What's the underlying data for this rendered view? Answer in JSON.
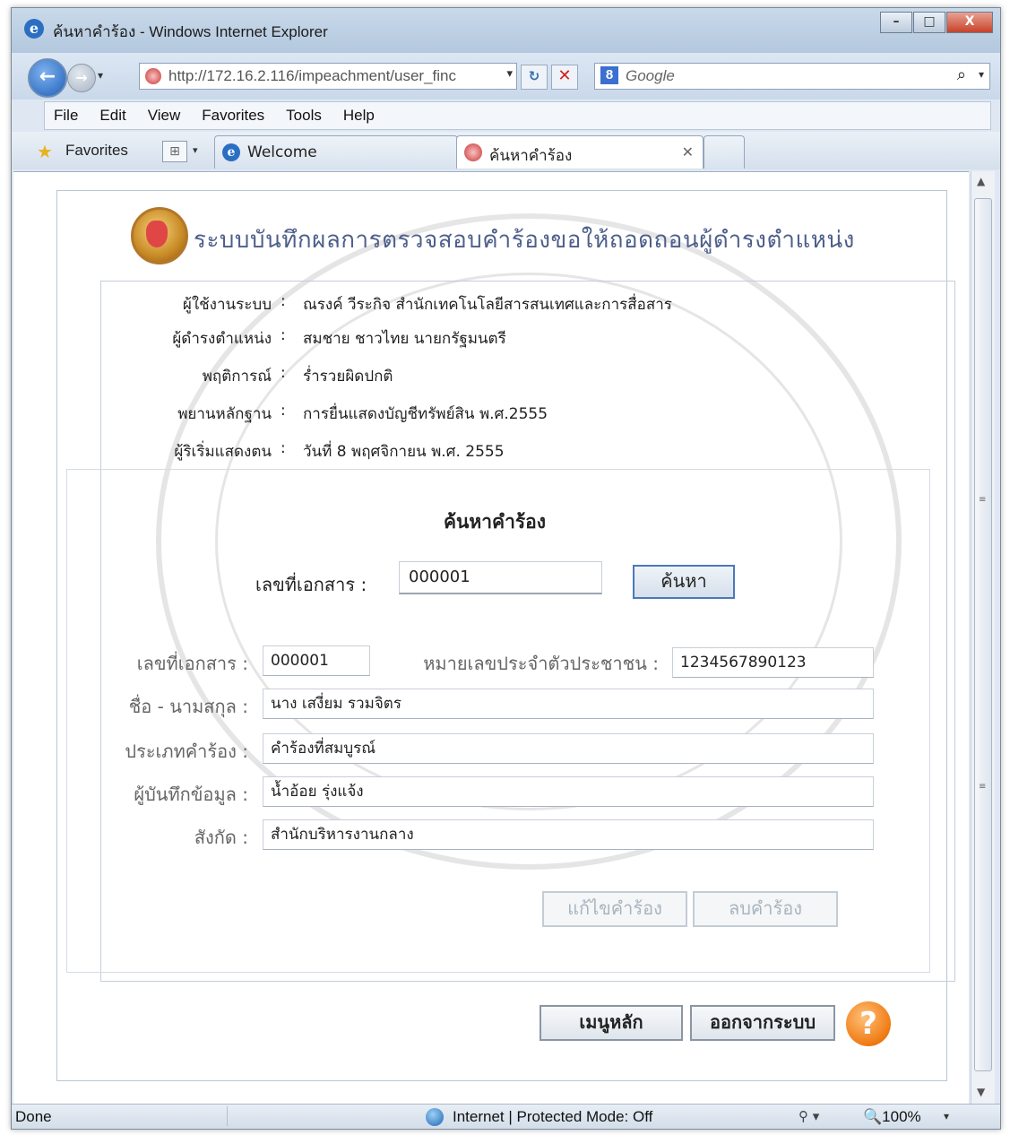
{
  "window": {
    "title": "ค้นหาคำร้อง - Windows Internet Explorer",
    "minimize": "–",
    "maximize": "□",
    "close": "X"
  },
  "address": {
    "url": "http://172.16.2.116/impeachment/user_finc",
    "search_placeholder": "Google"
  },
  "menu": [
    "File",
    "Edit",
    "View",
    "Favorites",
    "Tools",
    "Help"
  ],
  "favorites": {
    "label": "Favorites",
    "tabs": [
      {
        "label": "Welcome"
      },
      {
        "label": "ค้นหาคำร้อง"
      }
    ]
  },
  "page": {
    "header_title": "ระบบบันทึกผลการตรวจสอบคำร้องขอให้ถอดถอนผู้ดำรงตำแหน่ง",
    "info": [
      {
        "label": "ผู้ใช้งานระบบ",
        "value": "ณรงค์  วีระกิจ  สำนักเทคโนโลยีสารสนเทศและการสื่อสาร"
      },
      {
        "label": "ผู้ดำรงตำแหน่ง",
        "value": "สมชาย  ชาวไทย  นายกรัฐมนตรี"
      },
      {
        "label": "พฤติการณ์",
        "value": "ร่ำรวยผิดปกติ"
      },
      {
        "label": "พยานหลักฐาน",
        "value": "การยื่นแสดงบัญชีทรัพย์สิน พ.ศ.2555"
      },
      {
        "label": "ผู้ริเริ่มแสดงตน",
        "value": "วันที่ 8 พฤศจิกายน พ.ศ. 2555"
      }
    ],
    "search": {
      "title": "ค้นหาคำร้อง",
      "doc_label": "เลขที่เอกสาร",
      "doc_value": "000001",
      "button": "ค้นหา"
    },
    "form": {
      "doc_label": "เลขที่เอกสาร",
      "doc_value": "000001",
      "id_label": "หมายเลขประจำตัวประชาชน",
      "id_value": "1234567890123",
      "name_label": "ชื่อ - นามสกุล",
      "name_value": "นาง เสงี่ยม  รวมจิตร",
      "type_label": "ประเภทคำร้อง",
      "type_value": "คำร้องที่สมบูรณ์",
      "recorder_label": "ผู้บันทึกข้อมูล",
      "recorder_value": "น้ำอ้อย รุ่งแจ้ง",
      "dept_label": "สังกัด",
      "dept_value": "สำนักบริหารงานกลาง"
    },
    "buttons": {
      "edit": "แก้ไขคำร้อง",
      "delete": "ลบคำร้อง",
      "main_menu": "เมนูหลัก",
      "logout": "ออกจากระบบ",
      "help": "?"
    }
  },
  "status": {
    "left": "Done",
    "zone": "Internet | Protected Mode: Off",
    "zoom": "100%"
  }
}
